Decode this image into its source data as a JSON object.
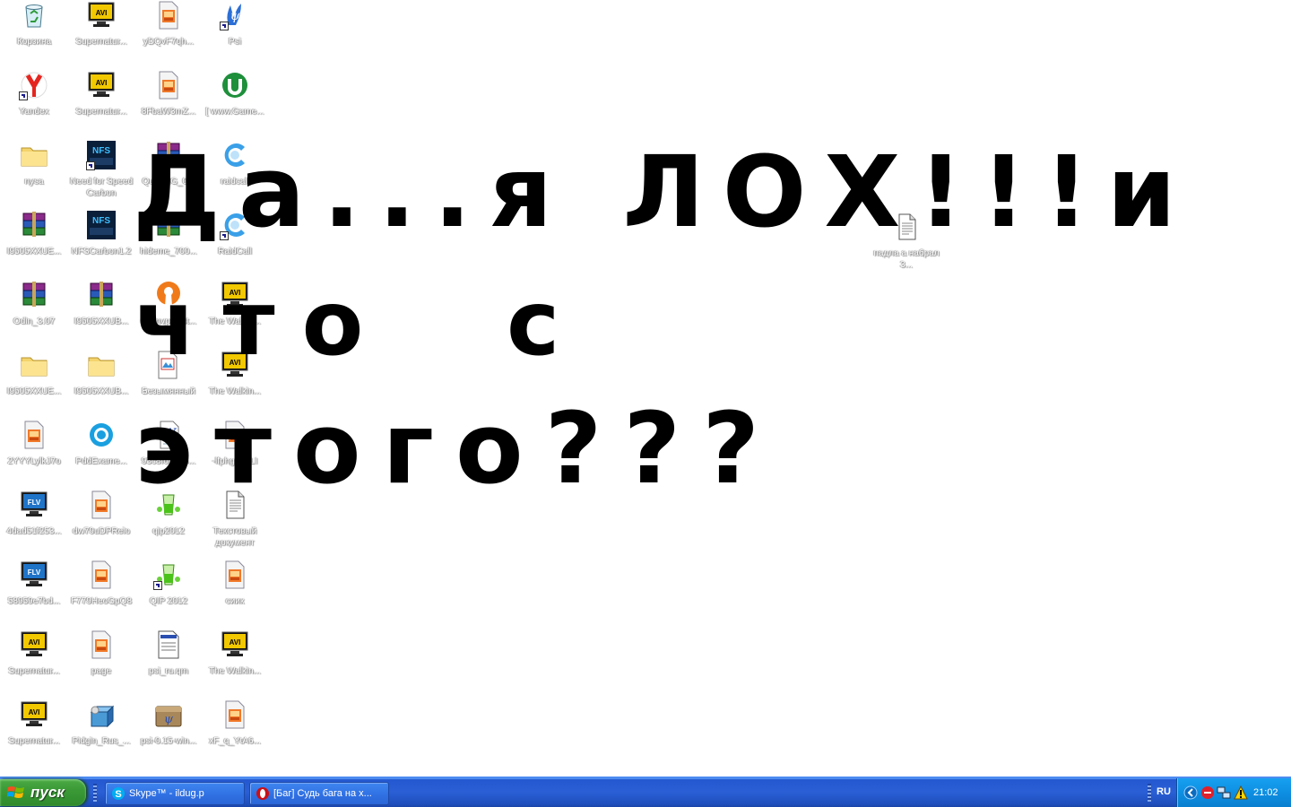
{
  "desktop": {
    "icons": [
      {
        "label": "Корзина",
        "icon": "recycle-bin-icon",
        "col": 0,
        "row": 0
      },
      {
        "label": "Supernatur...",
        "icon": "avi-video-icon",
        "col": 1,
        "row": 0
      },
      {
        "label": "yDQvF7qh...",
        "icon": "image-file-icon",
        "col": 2,
        "row": 0
      },
      {
        "label": "Psi",
        "icon": "psi-icon",
        "col": 3,
        "row": 0,
        "shortcut": true
      },
      {
        "label": "Yandex",
        "icon": "yandex-icon",
        "col": 0,
        "row": 1,
        "shortcut": true
      },
      {
        "label": "Supernatur...",
        "icon": "avi-video-icon",
        "col": 1,
        "row": 1
      },
      {
        "label": "8FbaW3mZ...",
        "icon": "image-file-icon",
        "col": 2,
        "row": 1
      },
      {
        "label": "[ www.Game...",
        "icon": "utorrent-icon",
        "col": 3,
        "row": 1
      },
      {
        "label": "nysa",
        "icon": "folder-icon",
        "col": 0,
        "row": 2
      },
      {
        "label": "Need for Speed Carbon",
        "icon": "nfs-icon",
        "col": 1,
        "row": 2,
        "shortcut": true
      },
      {
        "label": "QuikIMG_0...",
        "icon": "winrar-archive-icon",
        "col": 2,
        "row": 2
      },
      {
        "label": "raidcall",
        "icon": "raidcall-icon",
        "col": 3,
        "row": 2
      },
      {
        "label": "I9505XXUE...",
        "icon": "winrar-archive-icon",
        "col": 0,
        "row": 3
      },
      {
        "label": "NFSCarbon1.2",
        "icon": "nfs-icon",
        "col": 1,
        "row": 3
      },
      {
        "label": "hideme_700...",
        "icon": "winrar-archive-icon",
        "col": 2,
        "row": 3
      },
      {
        "label": "RaidCall",
        "icon": "raidcall-icon",
        "col": 3,
        "row": 3,
        "shortcut": true
      },
      {
        "label": "Odin_3.07",
        "icon": "winrar-archive-icon",
        "col": 0,
        "row": 4
      },
      {
        "label": "I9505XXUB...",
        "icon": "winrar-archive-icon",
        "col": 1,
        "row": 4
      },
      {
        "label": "openvpninst...",
        "icon": "openvpn-icon",
        "col": 2,
        "row": 4
      },
      {
        "label": "The Walkin...",
        "icon": "avi-video-icon",
        "col": 3,
        "row": 4
      },
      {
        "label": "I9505XXUE...",
        "icon": "folder-icon",
        "col": 0,
        "row": 5
      },
      {
        "label": "I9505XXUB...",
        "icon": "folder-icon",
        "col": 1,
        "row": 5
      },
      {
        "label": "Безымянный",
        "icon": "paint-image-icon",
        "col": 2,
        "row": 5
      },
      {
        "label": "The Walkin...",
        "icon": "avi-video-icon",
        "col": 3,
        "row": 5
      },
      {
        "label": "2YYYLylkJ7o",
        "icon": "image-file-icon",
        "col": 0,
        "row": 6
      },
      {
        "label": "PddExame...",
        "icon": "pddexam-icon",
        "col": 1,
        "row": 6
      },
      {
        "label": "93c8f6b69b...",
        "icon": "word-document-icon",
        "col": 2,
        "row": 6
      },
      {
        "label": "-lfphg6FnLI",
        "icon": "image-file-icon",
        "col": 3,
        "row": 6
      },
      {
        "label": "4dad51f253...",
        "icon": "flv-video-icon",
        "col": 0,
        "row": 7
      },
      {
        "label": "dw79uDPReio",
        "icon": "image-file-icon",
        "col": 1,
        "row": 7
      },
      {
        "label": "qip2012",
        "icon": "qip-icon",
        "col": 2,
        "row": 7
      },
      {
        "label": "Текстовый документ",
        "icon": "text-document-icon",
        "col": 3,
        "row": 7
      },
      {
        "label": "58959e7bd...",
        "icon": "flv-video-icon",
        "col": 0,
        "row": 8
      },
      {
        "label": "F779HeoGpQ8",
        "icon": "image-file-icon",
        "col": 1,
        "row": 8
      },
      {
        "label": "QIP 2012",
        "icon": "qip-icon",
        "col": 2,
        "row": 8,
        "shortcut": true
      },
      {
        "label": "сиик",
        "icon": "image-file-icon",
        "col": 3,
        "row": 8
      },
      {
        "label": "Supernatur...",
        "icon": "avi-video-icon",
        "col": 0,
        "row": 9
      },
      {
        "label": "page",
        "icon": "image-file-icon",
        "col": 1,
        "row": 9
      },
      {
        "label": "psi_ru.qm",
        "icon": "qm-file-icon",
        "col": 2,
        "row": 9
      },
      {
        "label": "The Walkin...",
        "icon": "avi-video-icon",
        "col": 3,
        "row": 9
      },
      {
        "label": "Supernatur...",
        "icon": "avi-video-icon",
        "col": 0,
        "row": 10
      },
      {
        "label": "Pidgin_Rus_...",
        "icon": "pidgin-installer-icon",
        "col": 1,
        "row": 10
      },
      {
        "label": "psi-0.15-win...",
        "icon": "psi-installer-icon",
        "col": 2,
        "row": 10
      },
      {
        "label": "xF_q_YtA6...",
        "icon": "image-file-icon",
        "col": 3,
        "row": 10
      }
    ],
    "extra_icon": {
      "label": "падла а набрал 3...",
      "icon": "text-document-icon"
    }
  },
  "message": {
    "line1": "Да...я ЛОХ!!!и",
    "line2": "что  с",
    "line3": "этого???"
  },
  "taskbar": {
    "start_label": "пуск",
    "tasks": [
      {
        "label": "Skype™ - ildug.p",
        "icon": "skype-icon"
      },
      {
        "label": "[Баг] Судь бага на х...",
        "icon": "opera-icon"
      }
    ],
    "tray": {
      "language": "RU",
      "clock": "21:02",
      "icons": [
        "show-hidden-icon",
        "skype-tray-icon",
        "network-icon",
        "warning-icon"
      ]
    }
  },
  "colors": {
    "taskbar_blue": "#2458d0",
    "start_green": "#3b9a36",
    "tray_blue": "#0e8fe2",
    "desktop_bg": "#ffffff"
  }
}
